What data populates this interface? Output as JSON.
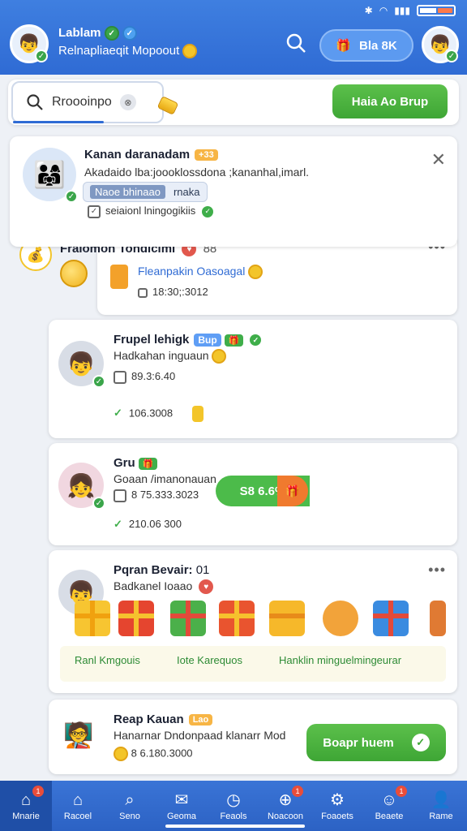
{
  "header": {
    "user_name": "Lablam",
    "user_subtitle": "Relnapliaeqit Mopoout",
    "gift_button_label": "Bla 8K"
  },
  "search": {
    "placeholder_text": "Rroooinpo",
    "add_group_label": "Haia Ao Brup"
  },
  "cards": [
    {
      "name": "Kanan daranadam",
      "tag": "+33",
      "text": "Akadaido lba:joooklossdona ;kananhal,imarl.",
      "chip_inner": "Naoe bhinaao",
      "chip_text": "rnaka",
      "chip_line": "seiaionl lningogikiis"
    },
    {
      "name": "Fralomon Tondiciml",
      "count": "88",
      "link": "Fleanpakin Oasoagal",
      "time": "18:30;:3012"
    },
    {
      "name": "Frupel lehigk",
      "tag": "Bup",
      "text": "Hadkahan inguaun",
      "time": "89.3:6.40",
      "coins": "106.3008"
    },
    {
      "name": "Gru",
      "text": "Goaan /imanonauan",
      "phone": "8 75.333.3023",
      "coins": "210.06 300",
      "pill": "S8 6.6%"
    },
    {
      "name": "Pqran Bevair:",
      "count": "01",
      "text": "Badkanel Ioaao",
      "gift_labels": [
        "Ranl Kmgouis",
        "Iote Karequos",
        "Hanklin minguelmingeurar"
      ]
    },
    {
      "name": "Reap Kauan",
      "tag": "Lao",
      "text": "Hanarnar Dndonpaad klanarr Mod",
      "phone": "8 6.180.3000",
      "button": "Boapr huem"
    }
  ],
  "nav": [
    {
      "label": "Mnarie",
      "icon": "home-icon",
      "badge": "1"
    },
    {
      "label": "Racoel",
      "icon": "folder-icon",
      "badge": ""
    },
    {
      "label": "Seno",
      "icon": "search-icon",
      "badge": ""
    },
    {
      "label": "Geoma",
      "icon": "mail-icon",
      "badge": ""
    },
    {
      "label": "Feaols",
      "icon": "compass-icon",
      "badge": ""
    },
    {
      "label": "Noacoon",
      "icon": "globe-icon",
      "badge": "1"
    },
    {
      "label": "Foaoets",
      "icon": "settings-icon",
      "badge": ""
    },
    {
      "label": "Beaete",
      "icon": "smile-icon",
      "badge": "1"
    },
    {
      "label": "Rame",
      "icon": "profile-icon",
      "badge": ""
    }
  ],
  "colors": {
    "header": "#2f6bd4",
    "accent_green": "#3ea635",
    "coin": "#f3c52a"
  }
}
